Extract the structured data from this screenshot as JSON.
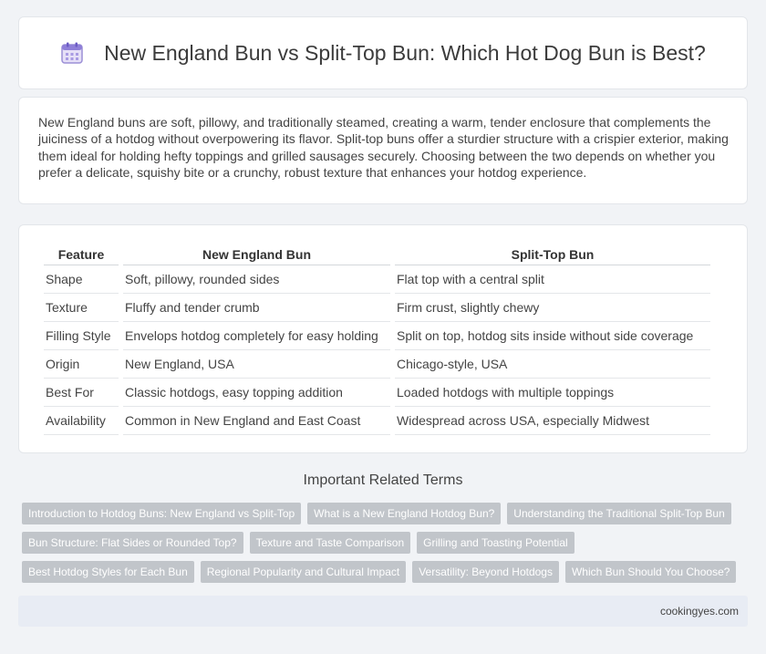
{
  "header": {
    "title": "New England Bun vs Split-Top Bun: Which Hot Dog Bun is Best?",
    "icon": "calendar-icon"
  },
  "intro": {
    "text": "New England buns are soft, pillowy, and traditionally steamed, creating a warm, tender enclosure that complements the juiciness of a hotdog without overpowering its flavor. Split-top buns offer a sturdier structure with a crispier exterior, making them ideal for holding hefty toppings and grilled sausages securely. Choosing between the two depends on whether you prefer a delicate, squishy bite or a crunchy, robust texture that enhances your hotdog experience."
  },
  "table": {
    "headers": [
      "Feature",
      "New England Bun",
      "Split-Top Bun"
    ],
    "rows": [
      [
        "Shape",
        "Soft, pillowy, rounded sides",
        "Flat top with a central split"
      ],
      [
        "Texture",
        "Fluffy and tender crumb",
        "Firm crust, slightly chewy"
      ],
      [
        "Filling Style",
        "Envelops hotdog completely for easy holding",
        "Split on top, hotdog sits inside without side coverage"
      ],
      [
        "Origin",
        "New England, USA",
        "Chicago-style, USA"
      ],
      [
        "Best For",
        "Classic hotdogs, easy topping addition",
        "Loaded hotdogs with multiple toppings"
      ],
      [
        "Availability",
        "Common in New England and East Coast",
        "Widespread across USA, especially Midwest"
      ]
    ]
  },
  "related": {
    "title": "Important Related Terms",
    "tags": [
      [
        "Introduction to Hotdog Buns: New England vs Split-Top",
        "What is a New England Hotdog Bun?",
        "Understanding the Traditional Split-Top Bun"
      ],
      [
        "Bun Structure: Flat Sides or Rounded Top?",
        "Texture and Taste Comparison",
        "Grilling and Toasting Potential"
      ],
      [
        "Best Hotdog Styles for Each Bun",
        "Regional Popularity and Cultural Impact",
        "Versatility: Beyond Hotdogs",
        "Which Bun Should You Choose?"
      ]
    ]
  },
  "footer": {
    "site": "cookingyes.com"
  }
}
